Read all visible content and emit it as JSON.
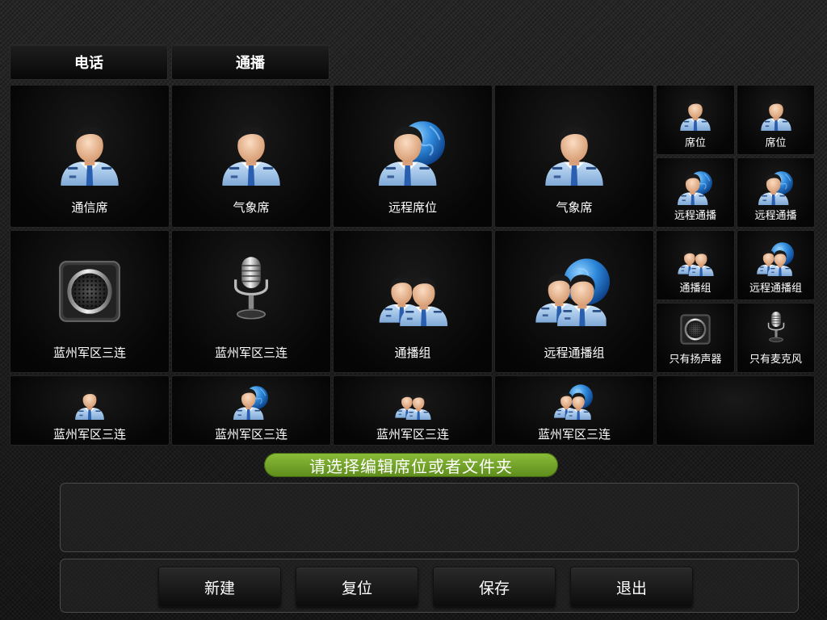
{
  "tabs": [
    {
      "label": "电话"
    },
    {
      "label": "通播"
    }
  ],
  "grid": {
    "big": [
      {
        "label": "通信席",
        "icon": "officer-icon"
      },
      {
        "label": "气象席",
        "icon": "officer-icon"
      },
      {
        "label": "远程席位",
        "icon": "remote-officer-icon"
      },
      {
        "label": "气象席",
        "icon": "officer-icon"
      },
      {
        "label": "蓝州军区三连",
        "icon": "speaker-icon"
      },
      {
        "label": "蓝州军区三连",
        "icon": "microphone-icon"
      },
      {
        "label": "通播组",
        "icon": "group-icon"
      },
      {
        "label": "远程通播组",
        "icon": "remote-group-icon"
      }
    ],
    "small": [
      {
        "label": "席位",
        "icon": "officer-icon"
      },
      {
        "label": "席位",
        "icon": "officer-icon"
      },
      {
        "label": "远程通播",
        "icon": "remote-officer-icon"
      },
      {
        "label": "远程通播",
        "icon": "remote-officer-icon"
      },
      {
        "label": "通播组",
        "icon": "group-icon"
      },
      {
        "label": "远程通播组",
        "icon": "remote-group-icon"
      },
      {
        "label": "只有扬声器",
        "icon": "speaker-icon"
      },
      {
        "label": "只有麦克风",
        "icon": "microphone-icon"
      }
    ],
    "wide": [
      {
        "label": "蓝州军区三连",
        "icon": "officer-icon"
      },
      {
        "label": "蓝州军区三连",
        "icon": "remote-officer-icon"
      },
      {
        "label": "蓝州军区三连",
        "icon": "group-icon"
      },
      {
        "label": "蓝州军区三连",
        "icon": "remote-group-icon"
      }
    ]
  },
  "hint": "请选择编辑席位或者文件夹",
  "buttons": {
    "new": "新建",
    "reset": "复位",
    "save": "保存",
    "exit": "退出"
  },
  "colors": {
    "accent_green": "#7aaa2c",
    "uniform_blue": "#9fc4ea",
    "globe_blue": "#2e86d6"
  }
}
